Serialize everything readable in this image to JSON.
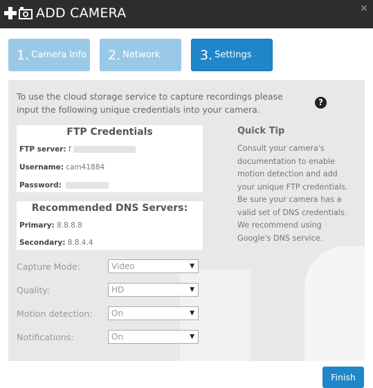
{
  "header": {
    "title": "ADD CAMERA",
    "close_icon": "×"
  },
  "steps": [
    {
      "num": "1.",
      "label": "Camera Info"
    },
    {
      "num": "2.",
      "label": "Network"
    },
    {
      "num": "3.",
      "label": "Settings"
    }
  ],
  "intro": "To use the cloud storage service to capture recordings please input the following unique credentials into your camera.",
  "help_icon": "?",
  "ftp": {
    "heading": "FTP Credentials",
    "server_label": "FTP server:",
    "server_value": "f",
    "username_label": "Username:",
    "username_value": "cam41884",
    "password_label": "Password:"
  },
  "dns": {
    "heading": "Recommended DNS Servers:",
    "primary_label": "Primary:",
    "primary_value": "8.8.8.8",
    "secondary_label": "Secondary:",
    "secondary_value": "8.8.4.4"
  },
  "tip": {
    "title": "Quick Tip",
    "body": "Consult your camera's documentation to enable motion detection and add your unique FTP credentials. Be sure your camera has a valid set of DNS credentials. We recommend using Google's DNS service."
  },
  "form": [
    {
      "label": "Capture Mode:",
      "value": "Video"
    },
    {
      "label": "Quality:",
      "value": "HD"
    },
    {
      "label": "Motion detection:",
      "value": "On"
    },
    {
      "label": "Notifications:",
      "value": "On"
    }
  ],
  "dropdown_arrow": "▼",
  "finish_label": "Finish"
}
